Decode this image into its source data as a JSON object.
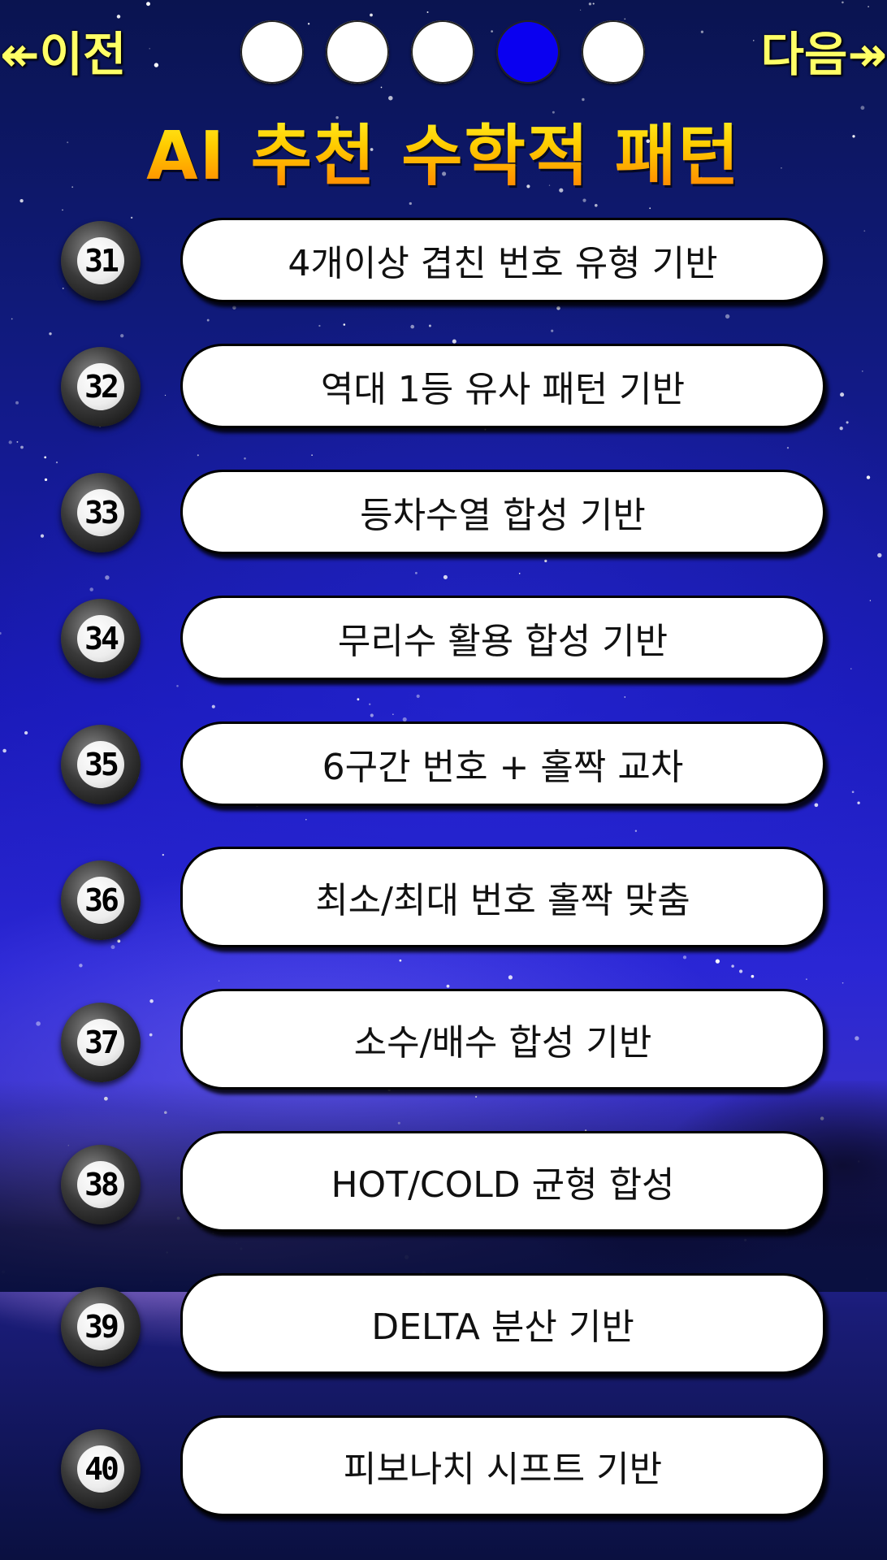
{
  "nav": {
    "prev_label": "↞이전",
    "next_label": "다음↠"
  },
  "pager": {
    "dots": 5,
    "active_index": 3
  },
  "title": "AI 추천 수학적 패턴",
  "patterns": [
    {
      "number": "31",
      "label": "4개이상 겹친 번호 유형 기반"
    },
    {
      "number": "32",
      "label": "역대 1등 유사 패턴 기반"
    },
    {
      "number": "33",
      "label": "등차수열 합성 기반"
    },
    {
      "number": "34",
      "label": "무리수 활용 합성 기반"
    },
    {
      "number": "35",
      "label": "6구간 번호 + 홀짝 교차"
    },
    {
      "number": "36",
      "label": "최소/최대 번호 홀짝 맞춤"
    },
    {
      "number": "37",
      "label": "소수/배수 합성 기반"
    },
    {
      "number": "38",
      "label": "HOT/COLD 균형 합성"
    },
    {
      "number": "39",
      "label": "DELTA 분산 기반"
    },
    {
      "number": "40",
      "label": "피보나치 시프트 기반"
    }
  ],
  "colors": {
    "active_dot": "#0a00f0",
    "title_top": "#ffff33",
    "title_bottom": "#ff7a00",
    "nav": "#ffff66"
  }
}
